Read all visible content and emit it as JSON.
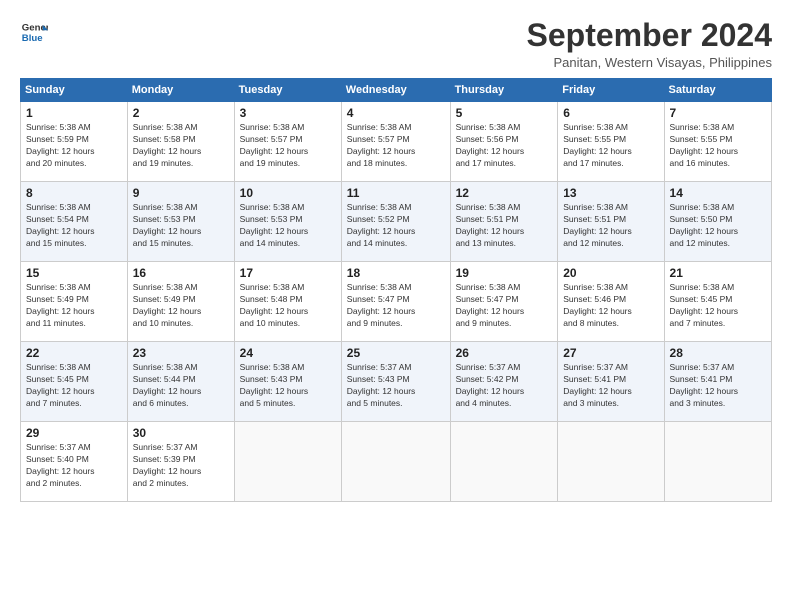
{
  "header": {
    "logo_line1": "General",
    "logo_line2": "Blue",
    "title": "September 2024",
    "subtitle": "Panitan, Western Visayas, Philippines"
  },
  "calendar": {
    "days_of_week": [
      "Sunday",
      "Monday",
      "Tuesday",
      "Wednesday",
      "Thursday",
      "Friday",
      "Saturday"
    ],
    "weeks": [
      [
        {
          "day": "",
          "info": ""
        },
        {
          "day": "2",
          "info": "Sunrise: 5:38 AM\nSunset: 5:58 PM\nDaylight: 12 hours\nand 19 minutes."
        },
        {
          "day": "3",
          "info": "Sunrise: 5:38 AM\nSunset: 5:57 PM\nDaylight: 12 hours\nand 19 minutes."
        },
        {
          "day": "4",
          "info": "Sunrise: 5:38 AM\nSunset: 5:57 PM\nDaylight: 12 hours\nand 18 minutes."
        },
        {
          "day": "5",
          "info": "Sunrise: 5:38 AM\nSunset: 5:56 PM\nDaylight: 12 hours\nand 17 minutes."
        },
        {
          "day": "6",
          "info": "Sunrise: 5:38 AM\nSunset: 5:55 PM\nDaylight: 12 hours\nand 17 minutes."
        },
        {
          "day": "7",
          "info": "Sunrise: 5:38 AM\nSunset: 5:55 PM\nDaylight: 12 hours\nand 16 minutes."
        }
      ],
      [
        {
          "day": "8",
          "info": "Sunrise: 5:38 AM\nSunset: 5:54 PM\nDaylight: 12 hours\nand 15 minutes."
        },
        {
          "day": "9",
          "info": "Sunrise: 5:38 AM\nSunset: 5:53 PM\nDaylight: 12 hours\nand 15 minutes."
        },
        {
          "day": "10",
          "info": "Sunrise: 5:38 AM\nSunset: 5:53 PM\nDaylight: 12 hours\nand 14 minutes."
        },
        {
          "day": "11",
          "info": "Sunrise: 5:38 AM\nSunset: 5:52 PM\nDaylight: 12 hours\nand 14 minutes."
        },
        {
          "day": "12",
          "info": "Sunrise: 5:38 AM\nSunset: 5:51 PM\nDaylight: 12 hours\nand 13 minutes."
        },
        {
          "day": "13",
          "info": "Sunrise: 5:38 AM\nSunset: 5:51 PM\nDaylight: 12 hours\nand 12 minutes."
        },
        {
          "day": "14",
          "info": "Sunrise: 5:38 AM\nSunset: 5:50 PM\nDaylight: 12 hours\nand 12 minutes."
        }
      ],
      [
        {
          "day": "15",
          "info": "Sunrise: 5:38 AM\nSunset: 5:49 PM\nDaylight: 12 hours\nand 11 minutes."
        },
        {
          "day": "16",
          "info": "Sunrise: 5:38 AM\nSunset: 5:49 PM\nDaylight: 12 hours\nand 10 minutes."
        },
        {
          "day": "17",
          "info": "Sunrise: 5:38 AM\nSunset: 5:48 PM\nDaylight: 12 hours\nand 10 minutes."
        },
        {
          "day": "18",
          "info": "Sunrise: 5:38 AM\nSunset: 5:47 PM\nDaylight: 12 hours\nand 9 minutes."
        },
        {
          "day": "19",
          "info": "Sunrise: 5:38 AM\nSunset: 5:47 PM\nDaylight: 12 hours\nand 9 minutes."
        },
        {
          "day": "20",
          "info": "Sunrise: 5:38 AM\nSunset: 5:46 PM\nDaylight: 12 hours\nand 8 minutes."
        },
        {
          "day": "21",
          "info": "Sunrise: 5:38 AM\nSunset: 5:45 PM\nDaylight: 12 hours\nand 7 minutes."
        }
      ],
      [
        {
          "day": "22",
          "info": "Sunrise: 5:38 AM\nSunset: 5:45 PM\nDaylight: 12 hours\nand 7 minutes."
        },
        {
          "day": "23",
          "info": "Sunrise: 5:38 AM\nSunset: 5:44 PM\nDaylight: 12 hours\nand 6 minutes."
        },
        {
          "day": "24",
          "info": "Sunrise: 5:38 AM\nSunset: 5:43 PM\nDaylight: 12 hours\nand 5 minutes."
        },
        {
          "day": "25",
          "info": "Sunrise: 5:37 AM\nSunset: 5:43 PM\nDaylight: 12 hours\nand 5 minutes."
        },
        {
          "day": "26",
          "info": "Sunrise: 5:37 AM\nSunset: 5:42 PM\nDaylight: 12 hours\nand 4 minutes."
        },
        {
          "day": "27",
          "info": "Sunrise: 5:37 AM\nSunset: 5:41 PM\nDaylight: 12 hours\nand 3 minutes."
        },
        {
          "day": "28",
          "info": "Sunrise: 5:37 AM\nSunset: 5:41 PM\nDaylight: 12 hours\nand 3 minutes."
        }
      ],
      [
        {
          "day": "29",
          "info": "Sunrise: 5:37 AM\nSunset: 5:40 PM\nDaylight: 12 hours\nand 2 minutes."
        },
        {
          "day": "30",
          "info": "Sunrise: 5:37 AM\nSunset: 5:39 PM\nDaylight: 12 hours\nand 2 minutes."
        },
        {
          "day": "",
          "info": ""
        },
        {
          "day": "",
          "info": ""
        },
        {
          "day": "",
          "info": ""
        },
        {
          "day": "",
          "info": ""
        },
        {
          "day": "",
          "info": ""
        }
      ]
    ],
    "week0_day1": {
      "day": "1",
      "info": "Sunrise: 5:38 AM\nSunset: 5:59 PM\nDaylight: 12 hours\nand 20 minutes."
    }
  }
}
